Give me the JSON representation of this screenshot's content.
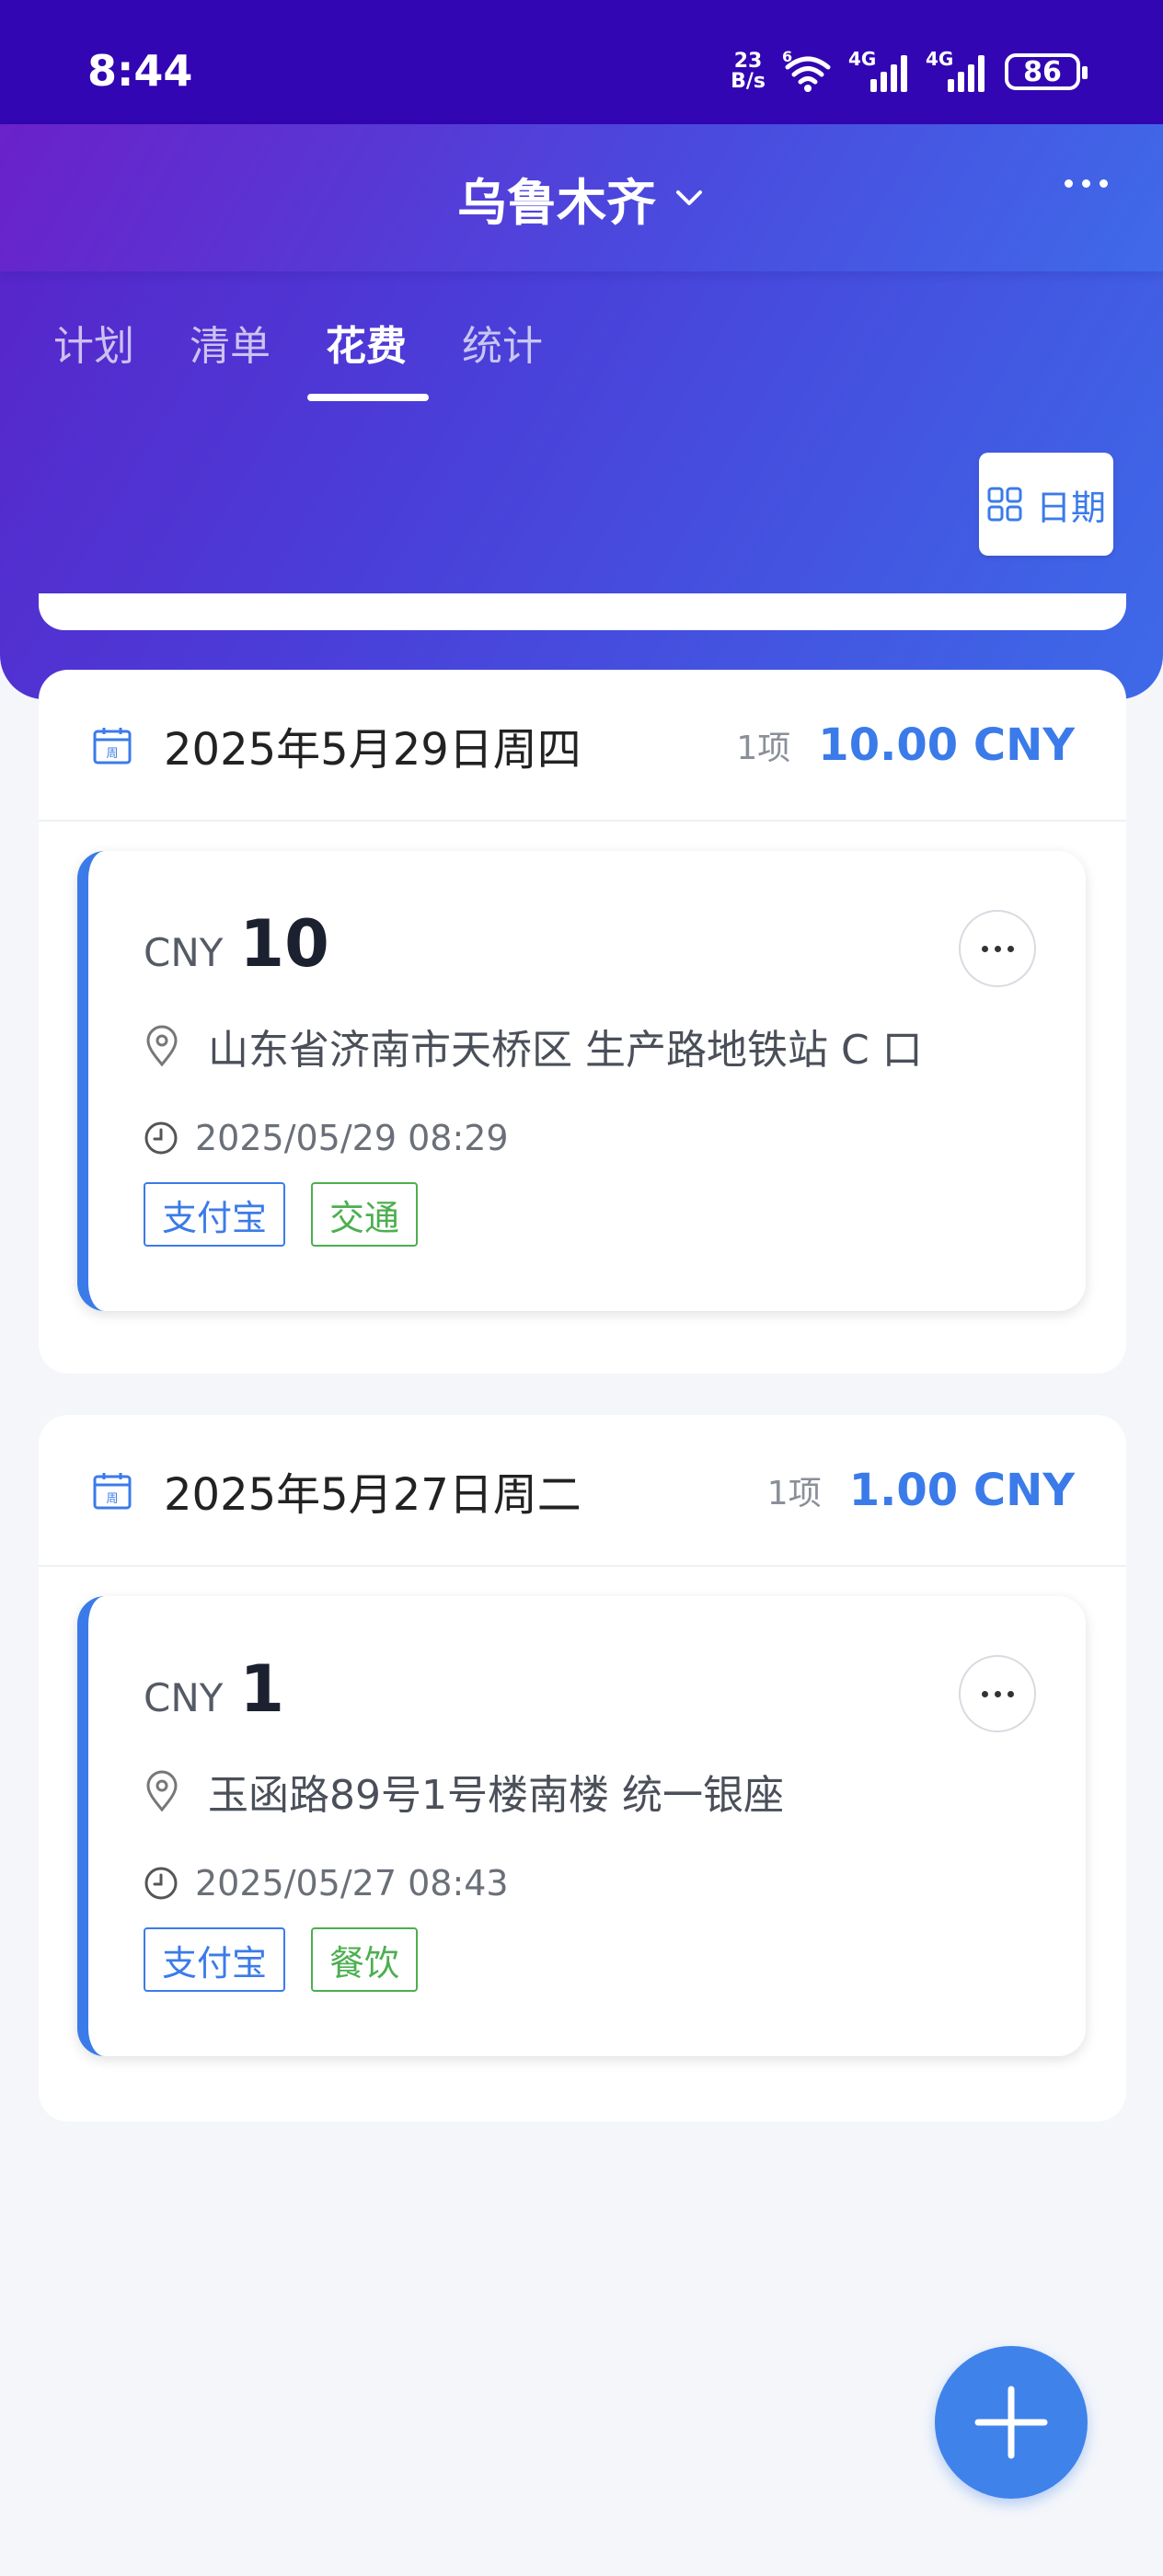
{
  "status_bar": {
    "time": "8:44",
    "net_speed_value": "23",
    "net_speed_unit": "B/s",
    "wifi_label": "6",
    "sim1_label": "4G",
    "sim2_label": "4G",
    "battery": "86"
  },
  "header": {
    "title": "乌鲁木齐"
  },
  "tabs": [
    {
      "label": "计划"
    },
    {
      "label": "清单"
    },
    {
      "label": "花费"
    },
    {
      "label": "统计"
    }
  ],
  "toolbar": {
    "date_button_label": "日期"
  },
  "groups": [
    {
      "date": "2025年5月29日周四",
      "count": "1项",
      "total": "10.00 CNY",
      "calendar_glyph": "周",
      "expenses": [
        {
          "currency": "CNY",
          "amount": "10",
          "location": "山东省济南市天桥区 生产路地铁站 C 口",
          "time": "2025/05/29 08:29",
          "payment": "支付宝",
          "category": "交通"
        }
      ]
    },
    {
      "date": "2025年5月27日周二",
      "count": "1项",
      "total": "1.00 CNY",
      "calendar_glyph": "周",
      "expenses": [
        {
          "currency": "CNY",
          "amount": "1",
          "location": "玉函路89号1号楼南楼 统一银座",
          "time": "2025/05/27 08:43",
          "payment": "支付宝",
          "category": "餐饮"
        }
      ]
    }
  ],
  "colors": {
    "accent": "#3b7be9",
    "status_bar": "#3206b2",
    "tag_category": "#4caf50"
  },
  "icons": {
    "more": "more-horizontal-icon",
    "chevron": "chevron-down-icon",
    "calendar": "calendar-icon",
    "location": "location-pin-icon",
    "clock": "clock-icon",
    "add": "plus-icon",
    "grid": "grid-icon"
  }
}
